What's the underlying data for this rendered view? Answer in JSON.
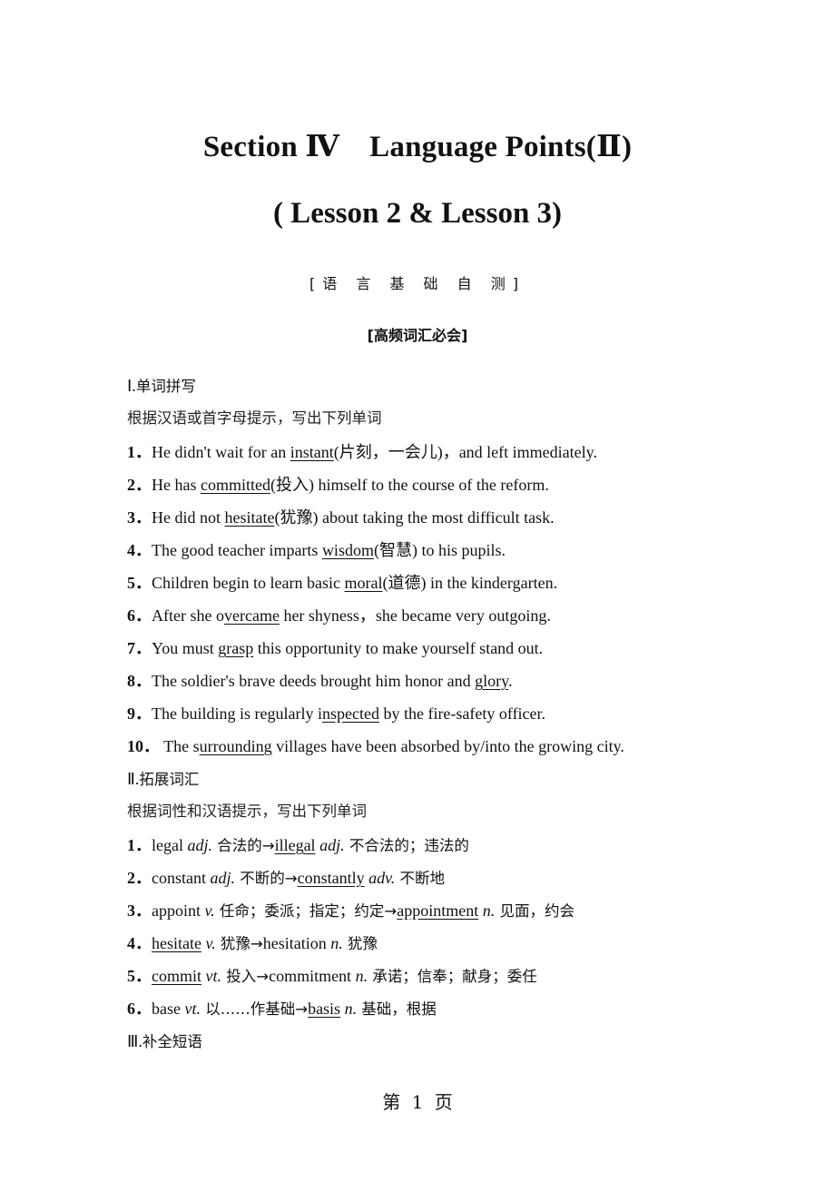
{
  "title": {
    "line1": "Section Ⅳ　Language Points(Ⅱ)",
    "line2": "( Lesson 2 & Lesson 3)",
    "sub1": "[语 言 基 础 自 测]",
    "sub2": "[高频词汇必会]"
  },
  "part1": {
    "heading_roman": "Ⅰ.",
    "heading_text": "单词拼写",
    "instruction": "根据汉语或首字母提示，写出下列单词",
    "items": [
      {
        "num": "1．",
        "pre": "He didn't wait for an ",
        "ans": "instant",
        "post": "(片刻，一会儿)，and left immediately."
      },
      {
        "num": "2．",
        "pre": "He has ",
        "ans": "committed",
        "post": "(投入) himself to the course of the reform."
      },
      {
        "num": "3．",
        "pre": "He did not ",
        "ans": "hesitate",
        "post": "(犹豫) about taking the most difficult task."
      },
      {
        "num": "4．",
        "pre": "The good teacher imparts ",
        "ans": "wisdom",
        "post": "(智慧) to his pupils."
      },
      {
        "num": "5．",
        "pre": "Children begin to learn basic ",
        "ans": "moral",
        "post": "(道德) in the kindergarten."
      },
      {
        "num": "6．",
        "pre": "After she o",
        "ans": "vercame",
        "post": " her shyness，she became very outgoing."
      },
      {
        "num": "7．",
        "pre": "You must ",
        "ans": "grasp",
        "post": " this opportunity to make yourself stand out."
      },
      {
        "num": "8．",
        "pre": "The soldier's brave deeds brought him honor and ",
        "ans": "glory",
        "post": "."
      },
      {
        "num": "9．",
        "pre": "The building is regularly i",
        "ans": "nspected",
        "post": " by the fire-safety officer."
      },
      {
        "num": "10．",
        "pre": " The s",
        "ans": "urrounding",
        "post": " villages have been absorbed by/into the growing city."
      }
    ]
  },
  "part2": {
    "heading_roman": "Ⅱ.",
    "heading_text": "拓展词汇",
    "instruction": "根据词性和汉语提示，写出下列单词",
    "items": [
      {
        "num": "1．",
        "a": "legal ",
        "a_u": false,
        "pos1": "adj.",
        "mean1": " 合法的→",
        "b": "illegal",
        "b_u": true,
        "pos2": " adj.",
        "mean2": " 不合法的；违法的"
      },
      {
        "num": "2．",
        "a": "constant ",
        "a_u": false,
        "pos1": "adj.",
        "mean1": " 不断的→",
        "b": "constantly",
        "b_u": true,
        "pos2": " adv.",
        "mean2": " 不断地"
      },
      {
        "num": "3．",
        "a": "appoint ",
        "a_u": false,
        "pos1": "v.",
        "mean1": " 任命；委派；指定；约定→",
        "b": "appointment",
        "b_u": true,
        "pos2": " n.",
        "mean2": " 见面，约会"
      },
      {
        "num": "4．",
        "a": "hesitate",
        "a_u": true,
        "pos1": " v.",
        "mean1": " 犹豫→",
        "b": "hesitation",
        "b_u": false,
        "pos2": " n.",
        "mean2": " 犹豫"
      },
      {
        "num": "5．",
        "a": "commit",
        "a_u": true,
        "pos1": " vt.",
        "mean1": " 投入→",
        "b": "commitment",
        "b_u": false,
        "pos2": " n.",
        "mean2": " 承诺；信奉；献身；委任"
      },
      {
        "num": "6．",
        "a": "base ",
        "a_u": false,
        "pos1": "vt.",
        "mean1": " 以……作基础→",
        "b": "basis",
        "b_u": true,
        "pos2": " n.",
        "mean2": " 基础，根据"
      }
    ]
  },
  "part3": {
    "heading_roman": "Ⅲ.",
    "heading_text": "补全短语"
  },
  "footer": {
    "page_label": "第 1 页"
  }
}
